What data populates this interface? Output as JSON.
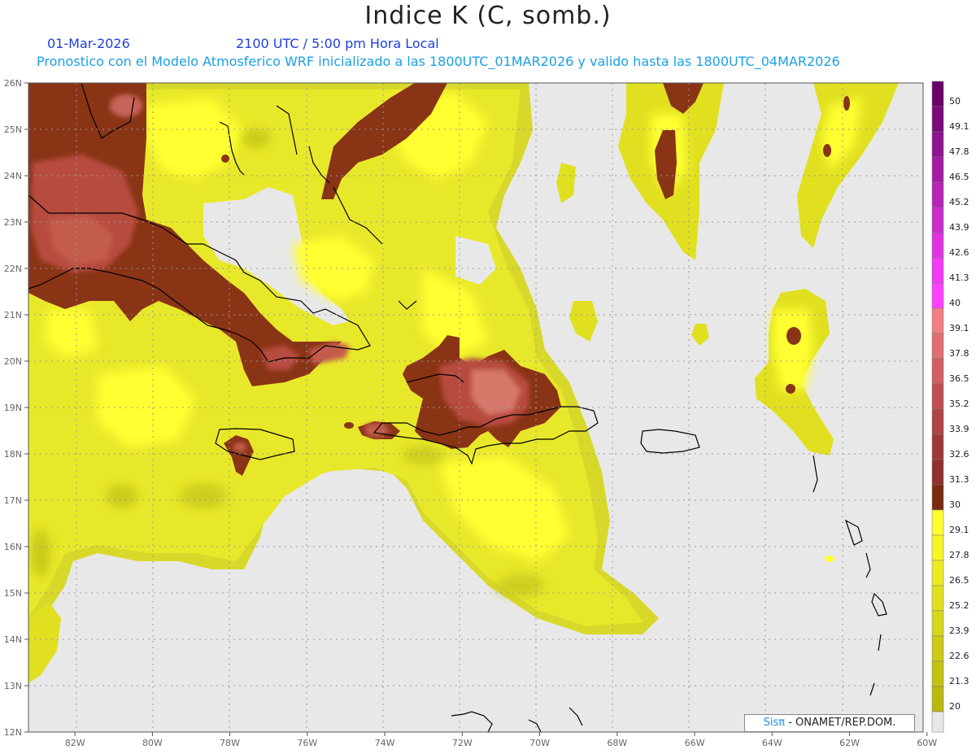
{
  "header": {
    "title": "Indice K (C, somb.)",
    "date": "01-Mar-2026",
    "time": "2100 UTC / 5:00 pm Hora Local",
    "info": "Pronostico con el Modelo Atmosferico WRF inicializado a las 1800UTC_01MAR2026 y valido hasta las  1800UTC_04MAR2026"
  },
  "map": {
    "lat_labels": [
      "26N",
      "25N",
      "24N",
      "23N",
      "22N",
      "21N",
      "20N",
      "19N",
      "18N",
      "17N",
      "16N",
      "15N",
      "14N",
      "13N",
      "12N"
    ],
    "lon_labels": [
      "82W",
      "80W",
      "78W",
      "76W",
      "74W",
      "72W",
      "70W",
      "68W",
      "66W",
      "64W",
      "62W",
      "60W"
    ],
    "lat_range": [
      12,
      26
    ],
    "lon_range": [
      -83.2,
      -60.1
    ],
    "background_color": "#e8e8e8",
    "grid": true
  },
  "legend": {
    "levels": [
      "50",
      "49.1",
      "47.8",
      "46.5",
      "45.2",
      "43.9",
      "42.6",
      "41.3",
      "40",
      "39.1",
      "37.8",
      "36.5",
      "35.2",
      "33.9",
      "32.6",
      "31.3",
      "30",
      "29.1",
      "27.8",
      "26.5",
      "25.2",
      "23.9",
      "22.6",
      "21.3",
      "20"
    ],
    "colors": [
      "#6a006a",
      "#7a0a7a",
      "#8f148f",
      "#a31ca3",
      "#b824b8",
      "#cc2ccc",
      "#e033e0",
      "#f23bf2",
      "#ff40ff",
      "#f08080",
      "#e07070",
      "#d06060",
      "#c05050",
      "#b04444",
      "#a03838",
      "#903030",
      "#7a2a10",
      "#ffff33",
      "#f5f528",
      "#ebeb24",
      "#e0e020",
      "#d6d61c",
      "#cccc18",
      "#c2c214",
      "#b8b810"
    ],
    "lowest_color": "#e8e8e8"
  },
  "credit": {
    "sis": "Sisπ",
    "rest": " - ONAMET/REP.DOM."
  }
}
